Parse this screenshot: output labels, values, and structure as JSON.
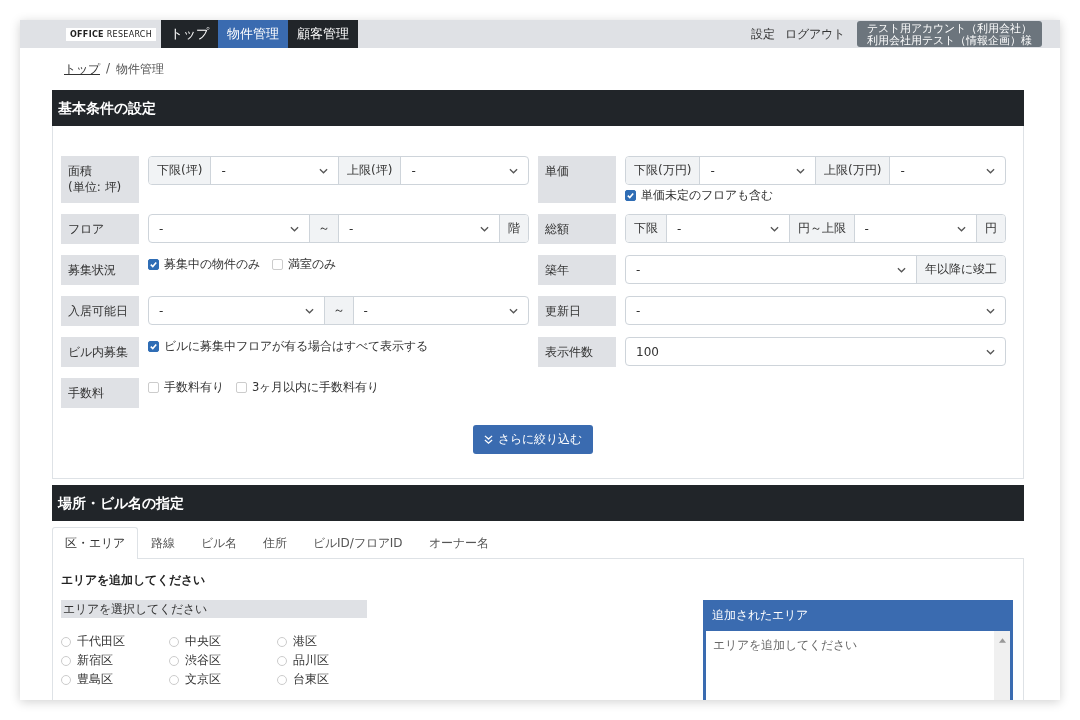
{
  "nav": {
    "logo": "**OFFICE** RESEARCH",
    "tabs": [
      {
        "label": "トップ",
        "selected": false
      },
      {
        "label": "物件管理",
        "selected": true
      },
      {
        "label": "顧客管理",
        "selected": false
      }
    ],
    "links": [
      "設定",
      "ログアウト"
    ],
    "account": [
      "テスト用アカウント（利用会社）",
      "利用会社用テスト（情報企画）様"
    ]
  },
  "breadcrumb": {
    "link": "トップ",
    "separator": "/",
    "current": "物件管理"
  },
  "basic": {
    "title": "基本条件の設定",
    "left": [
      {
        "label": "面積\n(単位: 坪)",
        "group": [
          {
            "kind": "addon",
            "text": "下限(坪)"
          },
          {
            "kind": "select",
            "value": "-"
          },
          {
            "kind": "addon",
            "text": "上限(坪)"
          },
          {
            "kind": "select",
            "value": "-"
          }
        ]
      },
      {
        "label": "フロア",
        "group": [
          {
            "kind": "select",
            "value": "-"
          },
          {
            "kind": "addon",
            "text": "～"
          },
          {
            "kind": "select",
            "value": "-"
          },
          {
            "kind": "addon",
            "text": "階"
          }
        ]
      },
      {
        "label": "募集状況",
        "checks": [
          {
            "label": "募集中の物件のみ",
            "checked": true
          },
          {
            "label": "満室のみ",
            "checked": false
          }
        ]
      },
      {
        "label": "入居可能日",
        "group": [
          {
            "kind": "select",
            "value": "-"
          },
          {
            "kind": "addon",
            "text": "～"
          },
          {
            "kind": "select",
            "value": "-"
          }
        ]
      },
      {
        "label": "ビル内募集",
        "checks": [
          {
            "label": "ビルに募集中フロアが有る場合はすべて表示する",
            "checked": true
          }
        ]
      },
      {
        "label": "手数料",
        "checks": [
          {
            "label": "手数料有り",
            "checked": false
          },
          {
            "label": "3ヶ月以内に手数料有り",
            "checked": false
          }
        ]
      }
    ],
    "right": [
      {
        "label": "単価",
        "group": [
          {
            "kind": "addon",
            "text": "下限(万円)"
          },
          {
            "kind": "select",
            "value": "-"
          },
          {
            "kind": "addon",
            "text": "上限(万円)"
          },
          {
            "kind": "select",
            "value": "-"
          }
        ],
        "checks": [
          {
            "label": "単価未定のフロアも含む",
            "checked": true
          }
        ]
      },
      {
        "label": "総額",
        "group": [
          {
            "kind": "addon",
            "text": "下限"
          },
          {
            "kind": "select",
            "value": "-"
          },
          {
            "kind": "addon",
            "text": "円～上限"
          },
          {
            "kind": "select",
            "value": "-"
          },
          {
            "kind": "addon",
            "text": "円"
          }
        ]
      },
      {
        "label": "築年",
        "group": [
          {
            "kind": "select",
            "value": "-"
          },
          {
            "kind": "addon",
            "text": "年以降に竣工"
          }
        ]
      },
      {
        "label": "更新日",
        "group": [
          {
            "kind": "select",
            "value": "-"
          }
        ]
      },
      {
        "label": "表示件数",
        "group": [
          {
            "kind": "select",
            "value": "100"
          }
        ]
      }
    ],
    "more_button": "さらに絞り込む"
  },
  "location": {
    "title": "場所・ビル名の指定",
    "tabs": [
      {
        "label": "区・エリア",
        "selected": true
      },
      {
        "label": "路線",
        "selected": false
      },
      {
        "label": "ビル名",
        "selected": false
      },
      {
        "label": "住所",
        "selected": false
      },
      {
        "label": "ビルID/フロアID",
        "selected": false
      },
      {
        "label": "オーナー名",
        "selected": false
      }
    ],
    "heading": "エリアを追加してください",
    "select_bar": "エリアを選択してください",
    "areas": [
      {
        "label": "千代田区",
        "selected": false
      },
      {
        "label": "中央区",
        "selected": false
      },
      {
        "label": "港区",
        "selected": false
      },
      {
        "label": "新宿区",
        "selected": false
      },
      {
        "label": "渋谷区",
        "selected": false
      },
      {
        "label": "品川区",
        "selected": false
      },
      {
        "label": "豊島区",
        "selected": false
      },
      {
        "label": "文京区",
        "selected": false
      },
      {
        "label": "台東区",
        "selected": false
      }
    ],
    "added_panel": {
      "title": "追加されたエリア",
      "placeholder": "エリアを追加してください"
    }
  }
}
